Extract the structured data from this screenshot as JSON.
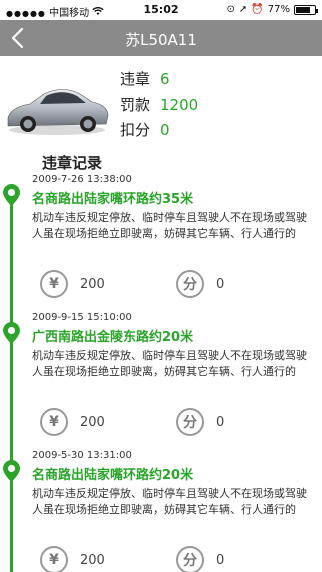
{
  "status_bar": {
    "carrier": "中国移动",
    "time": "15:02",
    "battery": "77%",
    "battery_level": 0.77
  },
  "header": {
    "title": "苏L50A11",
    "back_icon": "chevron-left-icon"
  },
  "car": {
    "image_icon": "car-photo",
    "violations_label": "违章",
    "violations_value": "6",
    "fine_label": "罚款",
    "fine_value": "1200",
    "points_label": "扣分",
    "points_value": "0"
  },
  "records_title": "违章记录",
  "colors": {
    "accent": "#2aa52a",
    "nav": "#8a8a8a"
  },
  "records": [
    {
      "date": "2009-7-26 13:38:00",
      "location": "名商路出陆家嘴环路约35米",
      "description": "机动车违反规定停放、临时停车且驾驶人不在现场或驾驶人虽在现场拒绝立即驶离，妨碍其它车辆、行人通行的",
      "fine_icon": "¥",
      "fine": "200",
      "points_icon": "分",
      "points": "0"
    },
    {
      "date": "2009-9-15 15:10:00",
      "location": "广西南路出金陵东路约20米",
      "description": "机动车违反规定停放、临时停车且驾驶人不在现场或驾驶人虽在现场拒绝立即驶离，妨碍其它车辆、行人通行的",
      "fine_icon": "¥",
      "fine": "200",
      "points_icon": "分",
      "points": "0"
    },
    {
      "date": "2009-5-30 13:31:00",
      "location": "名商路出陆家嘴环路约20米",
      "description": "机动车违反规定停放、临时停车且驾驶人不在现场或驾驶人虽在现场拒绝立即驶离，妨碍其它车辆、行人通行的",
      "fine_icon": "¥",
      "fine": "200",
      "points_icon": "分",
      "points": "0"
    }
  ]
}
